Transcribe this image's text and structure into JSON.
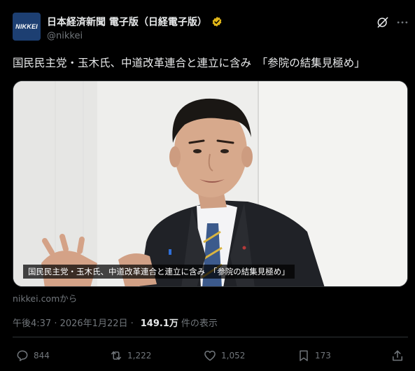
{
  "account": {
    "avatar_text": "NIKKEI",
    "display_name": "日本経済新聞 電子版（日経電子版）",
    "handle": "@nikkei",
    "verified_color": "#e2b719"
  },
  "post": {
    "text": "国民民主党・玉木氏、中道改革連合と連立に含み　「参院の結集見極め」",
    "media_caption": "国民民主党・玉木氏、中道改革連合と連立に含み　「参院の結集見極め」",
    "source": "nikkei.comから",
    "timestamp": "午後4:37 · 2026年1月22日 · ",
    "views": "149.1万",
    "views_label": "件の表示"
  },
  "actions": {
    "replies": "844",
    "reposts": "1,222",
    "likes": "1,052",
    "bookmarks": "173"
  },
  "colors": {
    "background": "#000000",
    "text": "#e7e9ea",
    "muted": "#71767b",
    "border": "#2f3336",
    "brand": "#1d3f72"
  }
}
